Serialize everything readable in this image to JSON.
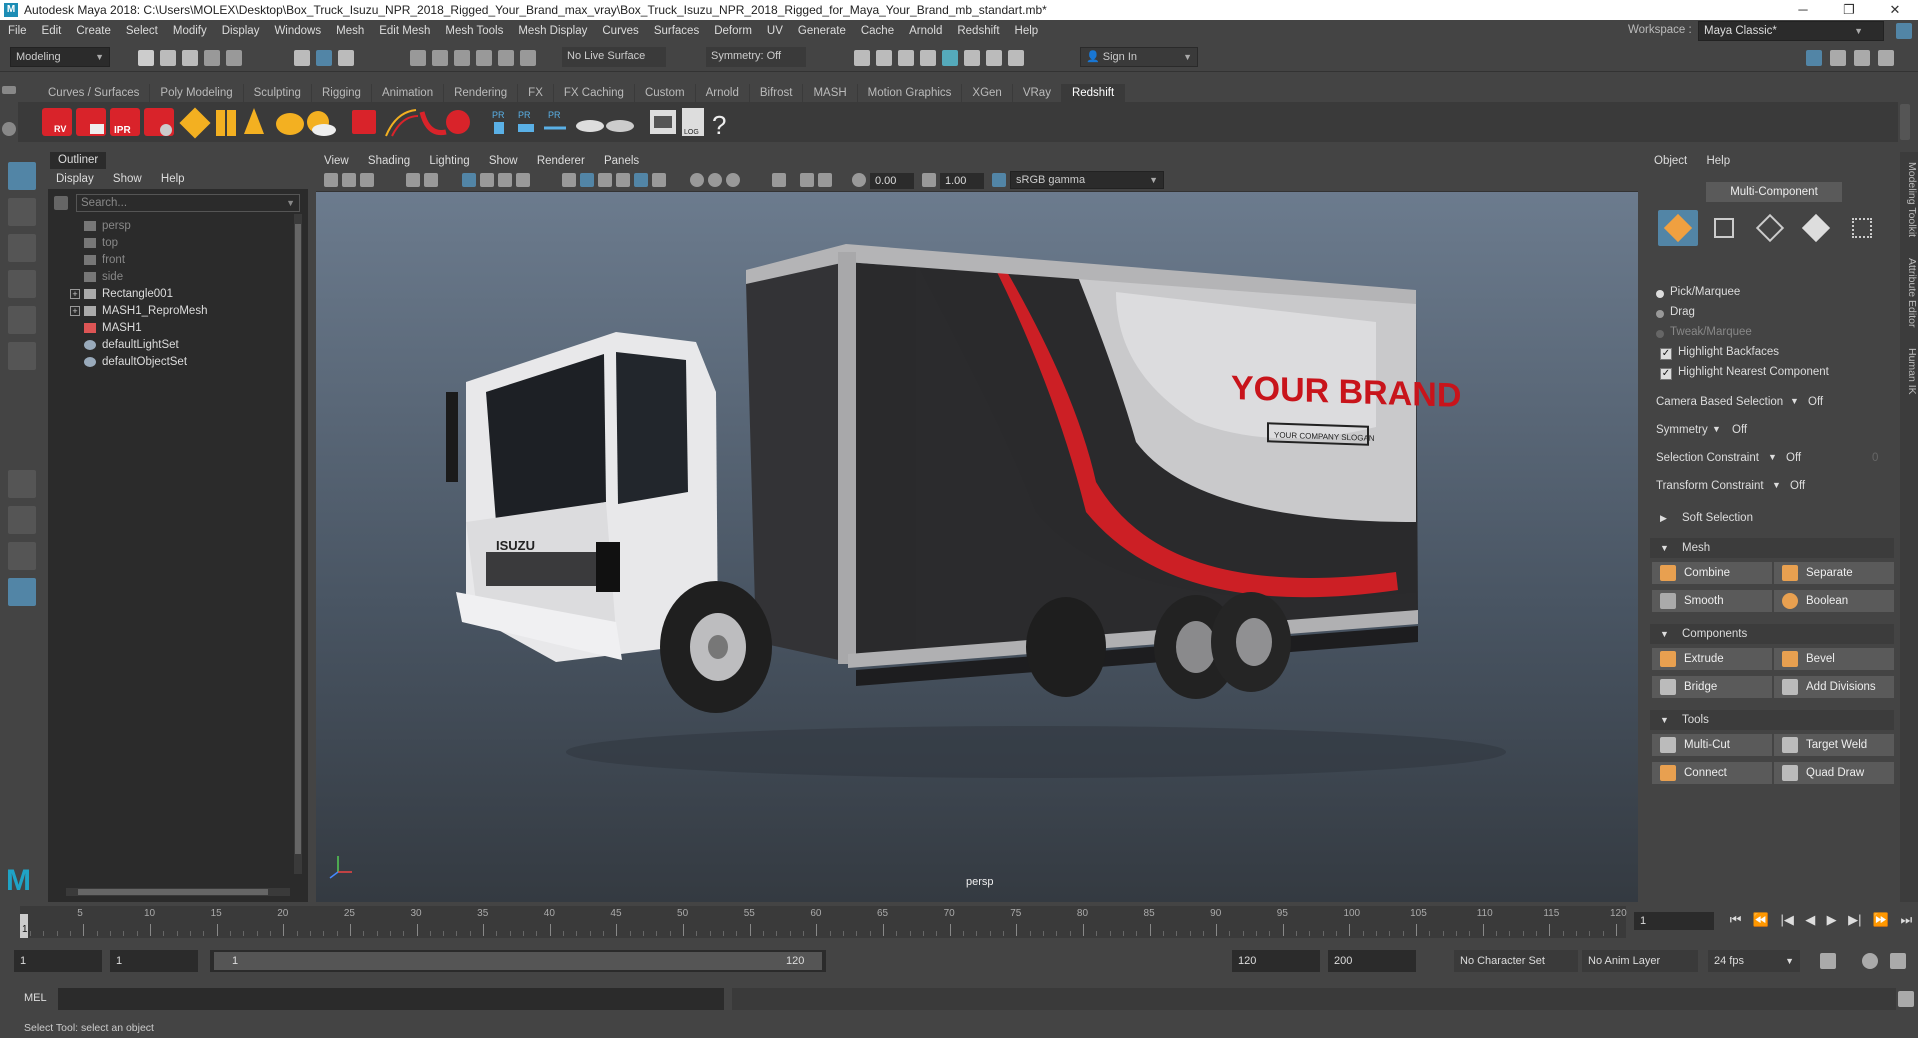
{
  "window": {
    "title": "Autodesk Maya 2018: C:\\Users\\MOLEX\\Desktop\\Box_Truck_Isuzu_NPR_2018_Rigged_Your_Brand_max_vray\\Box_Truck_Isuzu_NPR_2018_Rigged_for_Maya_Your_Brand_mb_standart.mb*",
    "minimize": "─",
    "maximize": "❐",
    "close": "✕"
  },
  "menubar": [
    "File",
    "Edit",
    "Create",
    "Select",
    "Modify",
    "Display",
    "Windows",
    "Mesh",
    "Edit Mesh",
    "Mesh Tools",
    "Mesh Display",
    "Curves",
    "Surfaces",
    "Deform",
    "UV",
    "Generate",
    "Cache",
    "Arnold",
    "Redshift",
    "Help"
  ],
  "workspace": {
    "label": "Workspace :",
    "value": "Maya Classic*"
  },
  "statusline": {
    "mode": "Modeling",
    "live_surface": "No Live Surface",
    "symmetry": "Symmetry: Off",
    "sign_in": "Sign In"
  },
  "shelf_tabs": [
    "Curves / Surfaces",
    "Poly Modeling",
    "Sculpting",
    "Rigging",
    "Animation",
    "Rendering",
    "FX",
    "FX Caching",
    "Custom",
    "Arnold",
    "Bifrost",
    "MASH",
    "Motion Graphics",
    "XGen",
    "VRay",
    "Redshift"
  ],
  "shelf_active": "Redshift",
  "shelf_icon_labels": {
    "rv": "RV",
    "ipr": "IPR",
    "pr": "PR",
    "log": "LOG",
    "help": "?"
  },
  "outliner": {
    "tab": "Outliner",
    "menu": [
      "Display",
      "Show",
      "Help"
    ],
    "search_placeholder": "Search...",
    "items": [
      {
        "label": "persp",
        "dim": true
      },
      {
        "label": "top",
        "dim": true
      },
      {
        "label": "front",
        "dim": true
      },
      {
        "label": "side",
        "dim": true
      },
      {
        "label": "Rectangle001",
        "dim": false
      },
      {
        "label": "MASH1_ReproMesh",
        "dim": false
      },
      {
        "label": "MASH1",
        "dim": false
      },
      {
        "label": "defaultLightSet",
        "dim": false
      },
      {
        "label": "defaultObjectSet",
        "dim": false
      }
    ]
  },
  "viewport": {
    "menu": [
      "View",
      "Shading",
      "Lighting",
      "Show",
      "Renderer",
      "Panels"
    ],
    "exposure": "0.00",
    "gamma": "1.00",
    "color_space": "sRGB gamma",
    "camera_label": "persp",
    "truck_text": {
      "brand": "YOUR BRAND",
      "slogan": "YOUR COMPANY SLOGAN",
      "grille": "ISUZU"
    }
  },
  "modeling_toolkit": {
    "menu": [
      "Object",
      "Help"
    ],
    "multi_component": "Multi-Component",
    "pick_options": [
      {
        "label": "Pick/Marquee",
        "dim": false
      },
      {
        "label": "Drag",
        "dim": false
      },
      {
        "label": "Tweak/Marquee",
        "dim": true
      }
    ],
    "checks": [
      "Highlight Backfaces",
      "Highlight Nearest Component"
    ],
    "rows": [
      {
        "label": "Camera Based Selection",
        "value": "Off"
      },
      {
        "label": "Symmetry",
        "value": "Off"
      },
      {
        "label": "Selection Constraint",
        "value": "Off",
        "extra": "0"
      },
      {
        "label": "Transform Constraint",
        "value": "Off"
      }
    ],
    "soft_selection": "Soft Selection",
    "sections": {
      "mesh": {
        "title": "Mesh",
        "buttons": [
          "Combine",
          "Separate",
          "Smooth",
          "Boolean"
        ]
      },
      "components": {
        "title": "Components",
        "buttons": [
          "Extrude",
          "Bevel",
          "Bridge",
          "Add Divisions"
        ]
      },
      "tools": {
        "title": "Tools",
        "buttons": [
          "Multi-Cut",
          "Target Weld",
          "Connect",
          "Quad Draw"
        ]
      }
    }
  },
  "side_strip": [
    "Modeling Toolkit",
    "Attribute Editor",
    "Human IK"
  ],
  "timeline": {
    "ticks": [
      "5",
      "10",
      "15",
      "20",
      "25",
      "30",
      "35",
      "40",
      "45",
      "50",
      "55",
      "60",
      "65",
      "70",
      "75",
      "80",
      "85",
      "90",
      "95",
      "100",
      "105",
      "110",
      "115",
      "120"
    ],
    "current_frame": "1",
    "first_tick": "1",
    "playback": [
      "⏮",
      "⏪",
      "|◀",
      "◀",
      "▶",
      "▶|",
      "⏩",
      "⏭"
    ]
  },
  "range": {
    "start": "1",
    "playback_start": "1",
    "slider_start": "1",
    "slider_end": "120",
    "playback_end": "120",
    "end": "200",
    "character_set": "No Character Set",
    "anim_layer": "No Anim Layer",
    "fps": "24 fps"
  },
  "mel": {
    "label": "MEL"
  },
  "helpline": "Select Tool: select an object",
  "colors": {
    "accent": "#5285a6",
    "panel": "#444444",
    "field": "#2b2b2b",
    "redshift": "#d9232a"
  }
}
